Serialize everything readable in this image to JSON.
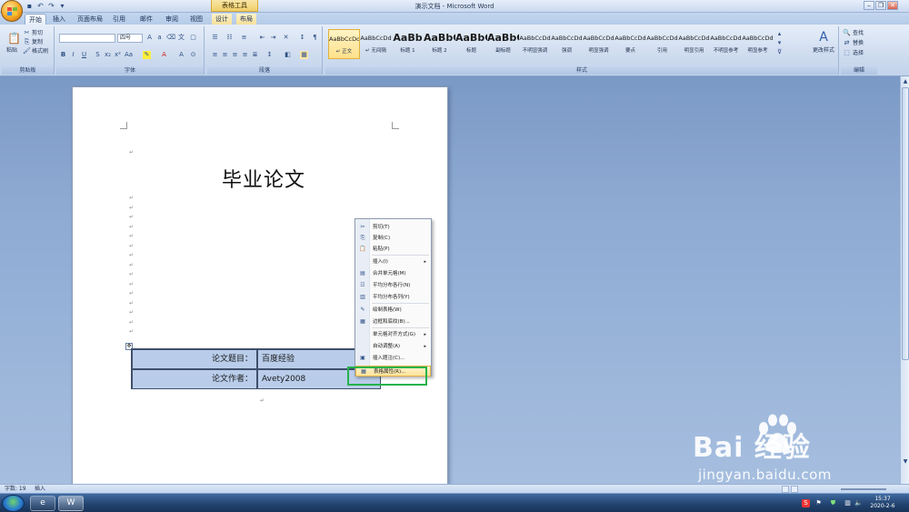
{
  "window": {
    "title": "演示文档 - Microsoft Word",
    "context_tools": "表格工具"
  },
  "tabs": [
    "开始",
    "插入",
    "页面布局",
    "引用",
    "邮件",
    "审阅",
    "视图",
    "设计",
    "布局"
  ],
  "ribbon": {
    "clipboard": {
      "paste": "粘贴",
      "cut": "剪切",
      "copy": "复制",
      "format_painter": "格式刷",
      "label": "剪贴板"
    },
    "font": {
      "font_size": "四号",
      "label": "字体"
    },
    "paragraph": {
      "label": "段落"
    },
    "styles": {
      "label": "样式",
      "items": [
        {
          "preview": "AaBbCcDd",
          "name": "↵ 正文"
        },
        {
          "preview": "AaBbCcDd",
          "name": "↵ 无间隔"
        },
        {
          "preview": "AaBb",
          "name": "标题 1"
        },
        {
          "preview": "AaBbC",
          "name": "标题 2"
        },
        {
          "preview": "AaBbC",
          "name": "标题"
        },
        {
          "preview": "AaBbC",
          "name": "副标题"
        },
        {
          "preview": "AaBbCcDd",
          "name": "不明显强调"
        },
        {
          "preview": "AaBbCcDd",
          "name": "强调"
        },
        {
          "preview": "AaBbCcDd",
          "name": "明显强调"
        },
        {
          "preview": "AaBbCcDd",
          "name": "要点"
        },
        {
          "preview": "AaBbCcDd",
          "name": "引用"
        },
        {
          "preview": "AaBbCcDd",
          "name": "明显引用"
        },
        {
          "preview": "AaBbCcDd",
          "name": "不明显参考"
        },
        {
          "preview": "AaBbCcDd",
          "name": "明显参考"
        }
      ],
      "change_styles": "更改样式"
    },
    "editing": {
      "find": "查找",
      "replace": "替换",
      "select": "选择",
      "label": "编辑"
    }
  },
  "document": {
    "title": "毕业论文",
    "table": [
      {
        "label": "论文题目：",
        "value": "百度经验"
      },
      {
        "label": "论文作者：",
        "value": "Avety2008"
      }
    ]
  },
  "context_menu": {
    "items": [
      {
        "label": "剪切(T)",
        "icon": "scissors-icon"
      },
      {
        "label": "复制(C)",
        "icon": "copy-icon"
      },
      {
        "label": "粘贴(P)",
        "icon": "paste-icon"
      },
      {
        "label": "插入(I)",
        "icon": "",
        "submenu": true
      },
      {
        "label": "合并单元格(M)",
        "icon": "merge-cells-icon"
      },
      {
        "label": "平均分布各行(N)",
        "icon": "distribute-rows-icon"
      },
      {
        "label": "平均分布各列(Y)",
        "icon": "distribute-columns-icon"
      },
      {
        "label": "绘制表格(W)",
        "icon": "draw-table-icon"
      },
      {
        "label": "边框和底纹(B)...",
        "icon": "borders-icon"
      },
      {
        "label": "单元格对齐方式(G)",
        "icon": "",
        "submenu": true
      },
      {
        "label": "自动调整(A)",
        "icon": "",
        "submenu": true
      },
      {
        "label": "插入题注(C)...",
        "icon": "caption-icon"
      },
      {
        "label": "表格属性(R)...",
        "icon": "table-properties-icon",
        "highlighted": true
      }
    ]
  },
  "statusbar": {
    "words": "字数: 19",
    "mode": "插入"
  },
  "taskbar": {
    "time": "15:37",
    "date": "2020-2-6"
  },
  "watermark": {
    "brand": "Bai 经验",
    "url": "jingyan.baidu.com"
  }
}
